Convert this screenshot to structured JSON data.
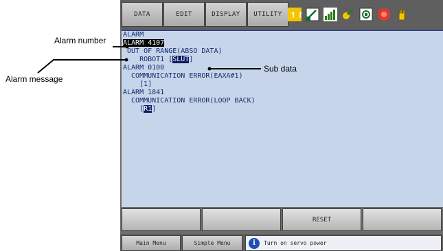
{
  "menu": {
    "items": [
      {
        "label": "DATA"
      },
      {
        "label": "EDIT"
      },
      {
        "label": "DISPLAY"
      },
      {
        "label": "UTILITY"
      }
    ]
  },
  "status_icons": [
    "coordinate-mode-icon",
    "edit-lock-icon",
    "signal-level-icon",
    "tool-icon",
    "memory-card-icon",
    "servo-stop-icon",
    "hand-icon"
  ],
  "screen": {
    "title": "ALARM",
    "lines": [
      {
        "prefix": "",
        "highlight": "ALARM 4107",
        "suffix": ""
      },
      {
        "prefix": " OUT OF RANGE(ABSO DATA)",
        "highlight": "",
        "suffix": ""
      },
      {
        "prefix": "    ROBOT1 [",
        "highlight": "SLUT",
        "suffix": "]"
      },
      {
        "prefix": "ALARM 0100",
        "highlight": "",
        "suffix": ""
      },
      {
        "prefix": "  COMMUNICATION ERROR(EAXA#1)",
        "highlight": "",
        "suffix": ""
      },
      {
        "prefix": "    [1]",
        "highlight": "",
        "suffix": ""
      },
      {
        "prefix": "ALARM 1841",
        "highlight": "",
        "suffix": ""
      },
      {
        "prefix": "  COMMUNICATION ERROR(LOOP BACK)",
        "highlight": "",
        "suffix": ""
      },
      {
        "prefix": "    [",
        "highlight": "R1",
        "suffix": "]"
      }
    ]
  },
  "function_keys": [
    {
      "label": ""
    },
    {
      "label": ""
    },
    {
      "label": "RESET"
    },
    {
      "label": ""
    }
  ],
  "bottom": {
    "main_menu": "Main Menu",
    "simple_menu": "Simple Menu",
    "message": "Turn on servo power"
  },
  "callouts": {
    "alarm_number": "Alarm number",
    "alarm_message": "Alarm message",
    "sub_data": "Sub data"
  },
  "colors": {
    "screen_bg": "#c7d5ea",
    "screen_text": "#122a6f",
    "highlight": "#0d1a66"
  }
}
